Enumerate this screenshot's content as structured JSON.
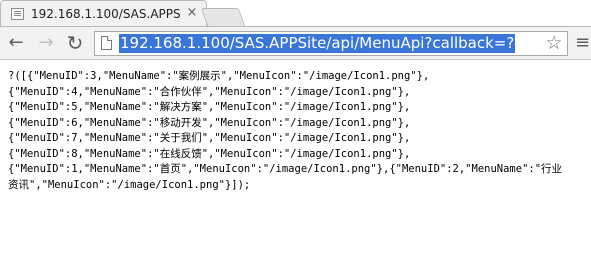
{
  "tab": {
    "title": "192.168.1.100/SAS.APPS",
    "close_label": "×"
  },
  "toolbar": {
    "back_glyph": "←",
    "forward_glyph": "→",
    "reload_glyph": "↻",
    "url": "192.168.1.100/SAS.APPSite/api/MenuApi?callback=?",
    "star_glyph": "☆",
    "menu_glyph": "≡"
  },
  "colors": {
    "url_selection": "#3a76d8",
    "tab_background": "#f2f2f2"
  },
  "page": {
    "lines": [
      "?([{\"MenuID\":3,\"MenuName\":\"案例展示\",\"MenuIcon\":\"/image/Icon1.png\"},",
      "{\"MenuID\":4,\"MenuName\":\"合作伙伴\",\"MenuIcon\":\"/image/Icon1.png\"},",
      "{\"MenuID\":5,\"MenuName\":\"解决方案\",\"MenuIcon\":\"/image/Icon1.png\"},",
      "{\"MenuID\":6,\"MenuName\":\"移动开发\",\"MenuIcon\":\"/image/Icon1.png\"},",
      "{\"MenuID\":7,\"MenuName\":\"关于我们\",\"MenuIcon\":\"/image/Icon1.png\"},",
      "{\"MenuID\":8,\"MenuName\":\"在线反馈\",\"MenuIcon\":\"/image/Icon1.png\"},",
      "{\"MenuID\":1,\"MenuName\":\"首页\",\"MenuIcon\":\"/image/Icon1.png\"},{\"MenuID\":2,\"MenuName\":\"行业",
      "资讯\",\"MenuIcon\":\"/image/Icon1.png\"}]);"
    ]
  }
}
